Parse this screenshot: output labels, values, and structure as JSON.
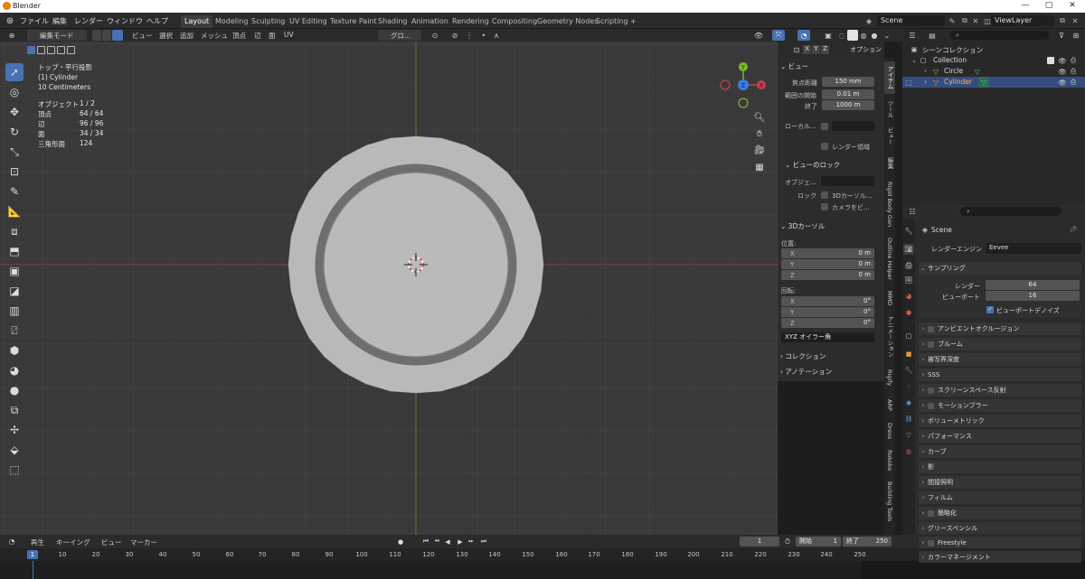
{
  "title_bar": {
    "title": "Blender",
    "minimize": "—",
    "maximize": "▢",
    "close": "✕"
  },
  "menubar": {
    "menus": [
      "ファイル",
      "編集",
      "レンダー",
      "ウィンドウ",
      "ヘルプ"
    ],
    "workspaces": [
      "Layout",
      "Modeling",
      "Sculpting",
      "UV Editing",
      "Texture Paint",
      "Shading",
      "Animation",
      "Rendering",
      "Compositing",
      "Geometry Nodes",
      "Scripting"
    ],
    "active_workspace": "Layout",
    "add_tab": "+",
    "scene": "Scene",
    "view_layer": "ViewLayer"
  },
  "viewport_header": {
    "mode": "編集モード",
    "menus": [
      "ビュー",
      "選択",
      "追加",
      "メッシュ",
      "頂点",
      "辺",
      "面",
      "UV"
    ],
    "transform_orientation": "グロ...",
    "options": "オプション",
    "axes": [
      "X",
      "Y",
      "Z"
    ]
  },
  "viewport_overlay": {
    "view_name": "トップ・平行投影",
    "object_name": "(1) Cylinder",
    "grid_scale": "10 Centimeters",
    "stats": [
      {
        "label": "オブジェクト",
        "value": "1 / 2"
      },
      {
        "label": "頂点",
        "value": "64 / 64"
      },
      {
        "label": "辺",
        "value": "96 / 96"
      },
      {
        "label": "面",
        "value": "34 / 34"
      },
      {
        "label": "三角形面",
        "value": "124"
      }
    ]
  },
  "npanel": {
    "view_header": "ビュー",
    "focal_label": "焦点距離",
    "focal_value": "150 mm",
    "clip_start_label": "範囲の開始",
    "clip_start_value": "0.01 m",
    "clip_end_label": "終了",
    "clip_end_value": "1000 m",
    "local_camera_label": "ローカル...",
    "render_region_label": "レンダー領域",
    "view_lock_header": "ビューのロック",
    "object_label": "オブジェ...",
    "lock_label": "ロック",
    "lock_cursor_label": "3Dカーソル...",
    "lock_camera_label": "カメラをビ...",
    "cursor_header": "3Dカーソル",
    "location_label": "位置:",
    "loc_x_label": "X",
    "loc_x": "0 m",
    "loc_y_label": "Y",
    "loc_y": "0 m",
    "loc_z_label": "Z",
    "loc_z": "0 m",
    "rotation_label": "回転:",
    "rot_x_label": "X",
    "rot_x": "0°",
    "rot_y_label": "Y",
    "rot_y": "0°",
    "rot_z_label": "Z",
    "rot_z": "0°",
    "rotation_mode": "XYZ オイラー角",
    "collection_header": "コレクション",
    "annotation_header": "アノテーション"
  },
  "vertical_tabs": [
    "アイテム",
    "ツール",
    "ビュー",
    "編集",
    "Rigid Body Gen",
    "Outline Helper",
    "MMD",
    "アニメーション",
    "Rigify",
    "ARP",
    "Dress",
    "Rokoko",
    "Building Tools"
  ],
  "outliner": {
    "scene_collection": "シーンコレクション",
    "items": [
      {
        "name": "Collection"
      },
      {
        "name": "Circle"
      },
      {
        "name": "Cylinder",
        "selected": true
      }
    ]
  },
  "properties": {
    "scene_name": "Scene",
    "render_engine_label": "レンダーエンジン",
    "render_engine": "Eevee",
    "sampling_header": "サンプリング",
    "render_label": "レンダー",
    "render_samples": "64",
    "viewport_label": "ビューポート",
    "viewport_samples": "16",
    "denoise_label": "ビューポートデノイズ",
    "sections": [
      {
        "label": "アンビエントオクルージョン",
        "checkbox": true
      },
      {
        "label": "ブルーム",
        "checkbox": true
      },
      {
        "label": "被写界深度",
        "checkbox": false
      },
      {
        "label": "SSS",
        "checkbox": false
      },
      {
        "label": "スクリーンスペース反射",
        "checkbox": true
      },
      {
        "label": "モーションブラー",
        "checkbox": true
      },
      {
        "label": "ボリューメトリック",
        "checkbox": false
      },
      {
        "label": "パフォーマンス",
        "checkbox": false
      },
      {
        "label": "カーブ",
        "checkbox": false
      },
      {
        "label": "影",
        "checkbox": false
      },
      {
        "label": "間接照明",
        "checkbox": false
      },
      {
        "label": "フィルム",
        "checkbox": false
      },
      {
        "label": "簡略化",
        "checkbox": true
      },
      {
        "label": "グリースペンシル",
        "checkbox": false
      },
      {
        "label": "Freestyle",
        "checkbox": true
      },
      {
        "label": "カラーマネージメント",
        "checkbox": false
      }
    ]
  },
  "timeline": {
    "menus": [
      "再生",
      "キーイング",
      "ビュー",
      "マーカー"
    ],
    "current_frame": "1",
    "start_label": "開始",
    "start": "1",
    "end_label": "終了",
    "end": "250",
    "ruler": [
      "1",
      "10",
      "20",
      "30",
      "40",
      "50",
      "60",
      "70",
      "80",
      "90",
      "100",
      "110",
      "120",
      "130",
      "140",
      "150",
      "160",
      "170",
      "180",
      "190",
      "200",
      "210",
      "220",
      "230",
      "240",
      "250"
    ]
  },
  "colors": {
    "accent": "#4772b3",
    "x_axis": "#c93e4b",
    "y_axis": "#7ab82a",
    "z_axis": "#3d7ce0",
    "mesh": "#b9b9b9"
  }
}
